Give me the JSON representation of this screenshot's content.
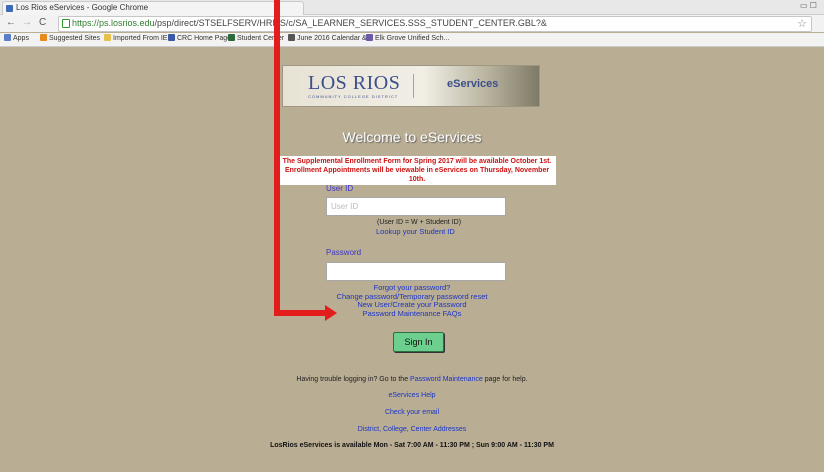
{
  "browser": {
    "tab_title": "Los Rios eServices - Google Chrome",
    "window_controls": "▭ ☐",
    "url_scheme_host": "https://ps.losrios.edu",
    "url_path": "/psp/direct/STSELFSERV/HRMS/c/SA_LEARNER_SERVICES.SSS_STUDENT_CENTER.GBL?&",
    "bookmarks": [
      "Apps",
      "Suggested Sites",
      "Imported From IE",
      "CRC Home Page",
      "Student Center",
      "June 2016 Calendar &",
      "Elk Grove Unified Sch..."
    ]
  },
  "banner": {
    "logo_text": "LOS RIOS",
    "logo_sub": "COMMUNITY COLLEGE DISTRICT",
    "product": "eServices"
  },
  "login": {
    "welcome": "Welcome to eServices",
    "notice_line1": "The Supplemental Enrollment Form for Spring 2017 will be available October 1st.",
    "notice_line2": "Enrollment Appointments will be viewable in eServices on Thursday, November 10th.",
    "userid_label": "User ID",
    "userid_placeholder": "User ID",
    "userid_hint": "(User ID = W + Student ID)",
    "lookup_link": "Lookup your Student ID",
    "password_label": "Password",
    "forgot_link": "Forgot your password?",
    "change_link": "Change password/Temporary password reset",
    "new_user_link": "New User/Create your Password",
    "faq_link": "Password Maintenance FAQs",
    "signin_label": "Sign In"
  },
  "footer": {
    "trouble_prefix": "Having trouble logging in? Go to the ",
    "trouble_link": "Password Maintenance",
    "trouble_suffix": " page for help.",
    "help_link": "eServices Help",
    "email_link": "Check your email",
    "addresses_link": "District, College, Center Addresses",
    "availability": "LosRios eServices is available Mon - Sat 7:00 AM - 11:30 PM ; Sun 9:00 AM - 11:30 PM"
  },
  "colors": {
    "page_bg": "#b9ad93",
    "link": "#1a35c9",
    "notice": "#cc1111",
    "signin_bg": "#6dcf8e",
    "annotation_arrow": "#e31c1c"
  }
}
